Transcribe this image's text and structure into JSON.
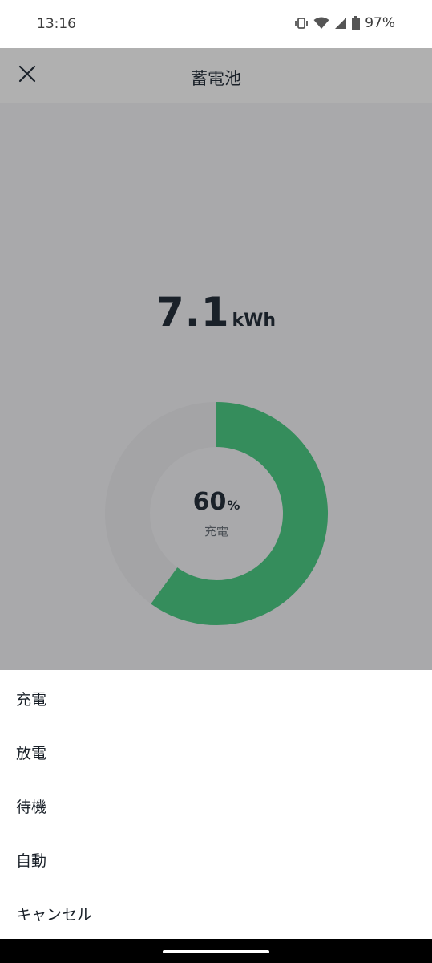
{
  "status_bar": {
    "time": "13:16",
    "battery_percent": "97%",
    "icons": [
      "vibrate-icon",
      "wifi-icon",
      "signal-icon",
      "battery-icon"
    ]
  },
  "header": {
    "title": "蓄電池",
    "close_icon": "close-icon"
  },
  "battery": {
    "energy_value": "7.1",
    "energy_unit": "kWh",
    "charge_percent": "60",
    "charge_percent_unit": "%",
    "charge_fraction": 0.6,
    "status": "充電"
  },
  "colors": {
    "gauge_fill": "#358d5c",
    "gauge_track": "#a4a4a6",
    "overlay": "#a9a9ab"
  },
  "action_sheet": {
    "items": [
      {
        "label": "充電"
      },
      {
        "label": "放電"
      },
      {
        "label": "待機"
      },
      {
        "label": "自動"
      },
      {
        "label": "キャンセル"
      }
    ]
  }
}
